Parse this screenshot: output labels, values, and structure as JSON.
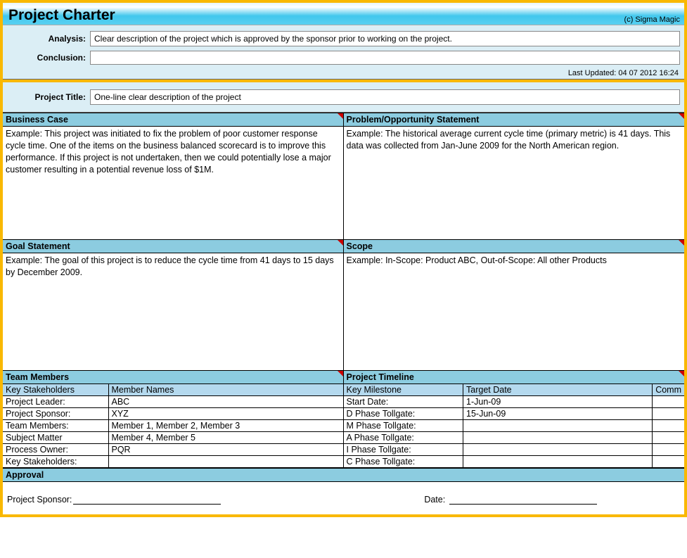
{
  "header": {
    "title": "Project Charter",
    "copyright": "(c) Sigma Magic"
  },
  "meta": {
    "analysis_label": "Analysis:",
    "analysis_value": "Clear description of the project which is approved by the sponsor prior to working on the project.",
    "conclusion_label": "Conclusion:",
    "conclusion_value": "",
    "last_updated": "Last Updated: 04 07 2012 16:24"
  },
  "project_title": {
    "label": "Project Title:",
    "value": "One-line clear description of the project"
  },
  "sections": {
    "business_case": {
      "heading": "Business Case",
      "body": "Example: This project was initiated to fix the problem of poor customer response cycle time. One of the items on the business balanced scorecard is to improve this performance. If this project is not undertaken, then we could potentially lose a major customer resulting in a potential revenue loss of $1M."
    },
    "problem": {
      "heading": "Problem/Opportunity Statement",
      "body": "Example: The historical average current cycle time (primary metric) is 41 days. This data was collected from Jan-June 2009 for the North American region."
    },
    "goal": {
      "heading": "Goal Statement",
      "body": "Example: The goal of this project is to reduce the cycle time from 41 days to 15 days by December 2009."
    },
    "scope": {
      "heading": "Scope",
      "body": "Example: In-Scope: Product ABC, Out-of-Scope: All other Products"
    },
    "team": {
      "heading": "Team Members",
      "col1": "Key Stakeholders",
      "col2": "Member Names",
      "rows": [
        {
          "a": "Project Leader:",
          "b": "ABC"
        },
        {
          "a": "Project Sponsor:",
          "b": "XYZ"
        },
        {
          "a": "Team Members:",
          "b": "Member 1, Member 2, Member 3"
        },
        {
          "a": "Subject Matter",
          "b": "Member 4, Member 5"
        },
        {
          "a": "Process Owner:",
          "b": "PQR"
        },
        {
          "a": "Key Stakeholders:",
          "b": ""
        }
      ]
    },
    "timeline": {
      "heading": "Project Timeline",
      "col1": "Key Milestone",
      "col2": "Target Date",
      "col3": "Comm",
      "rows": [
        {
          "a": "Start Date:",
          "b": "1-Jun-09",
          "c": ""
        },
        {
          "a": "D Phase Tollgate:",
          "b": "15-Jun-09",
          "c": ""
        },
        {
          "a": "M Phase Tollgate:",
          "b": "",
          "c": ""
        },
        {
          "a": "A Phase Tollgate:",
          "b": "",
          "c": ""
        },
        {
          "a": "I Phase Tollgate:",
          "b": "",
          "c": ""
        },
        {
          "a": "C Phase Tollgate:",
          "b": "",
          "c": ""
        }
      ]
    },
    "approval": {
      "heading": "Approval",
      "sponsor_label": "Project Sponsor:",
      "date_label": "Date:"
    }
  }
}
